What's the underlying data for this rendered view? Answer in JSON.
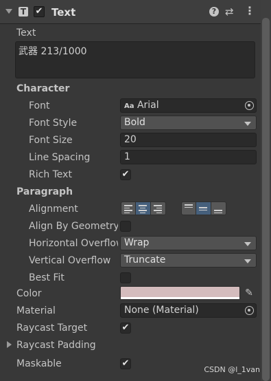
{
  "component": {
    "title": "Text",
    "icon": "text-component-icon",
    "enabled": true
  },
  "header_icons": [
    "help-icon",
    "presets-icon",
    "context-menu-icon"
  ],
  "text": {
    "label": "Text",
    "value": "武器 213/1000"
  },
  "character": {
    "title": "Character",
    "font_label": "Font",
    "font_icon_text": "Aa",
    "font_value": "Arial",
    "font_style_label": "Font Style",
    "font_style_value": "Bold",
    "font_size_label": "Font Size",
    "font_size_value": "20",
    "line_spacing_label": "Line Spacing",
    "line_spacing_value": "1",
    "rich_text_label": "Rich Text",
    "rich_text_checked": true
  },
  "paragraph": {
    "title": "Paragraph",
    "alignment_label": "Alignment",
    "horizontal_alignment": "center",
    "vertical_alignment": "middle",
    "align_by_geometry_label": "Align By Geometry",
    "align_by_geometry_checked": false,
    "horizontal_overflow_label": "Horizontal Overflow",
    "horizontal_overflow_value": "Wrap",
    "vertical_overflow_label": "Vertical Overflow",
    "vertical_overflow_value": "Truncate",
    "best_fit_label": "Best Fit",
    "best_fit_checked": false
  },
  "color": {
    "label": "Color",
    "value": "#D4BCBD"
  },
  "material": {
    "label": "Material",
    "value": "None (Material)"
  },
  "raycast_target": {
    "label": "Raycast Target",
    "checked": true
  },
  "raycast_padding": {
    "label": "Raycast Padding",
    "expanded": false
  },
  "maskable": {
    "label": "Maskable",
    "checked": true
  },
  "watermark": "CSDN @l_1van",
  "check_glyph": "✔"
}
